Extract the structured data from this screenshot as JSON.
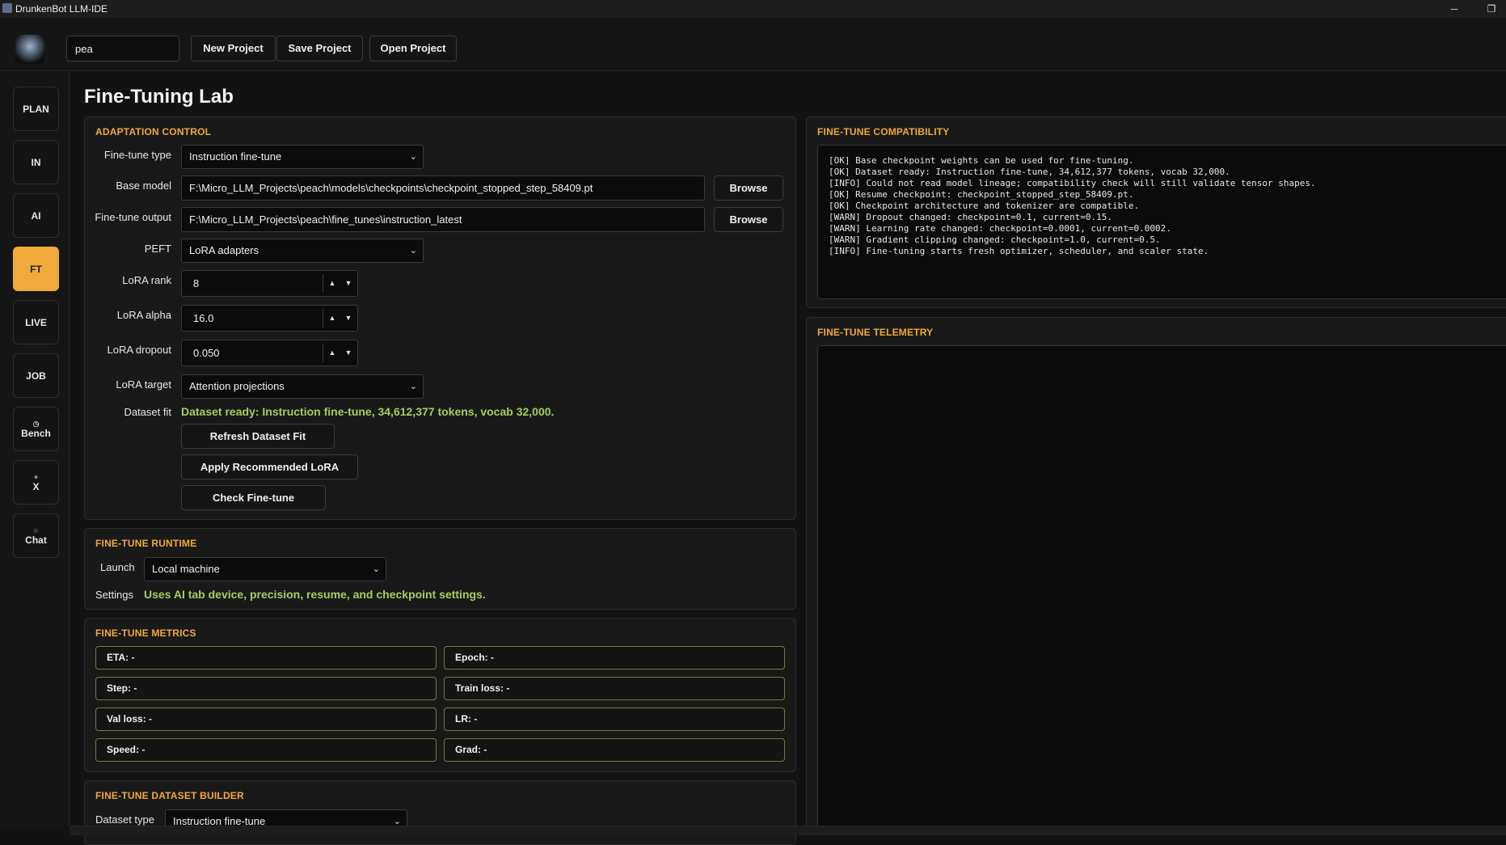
{
  "window": {
    "title": "DrunkenBot LLM-IDE",
    "minimize_glyph": "─",
    "restore_glyph": "❐"
  },
  "toolbar": {
    "project_value": "pea",
    "new_project": "New Project",
    "save_project": "Save Project",
    "open_project": "Open Project"
  },
  "sidebar": {
    "items": [
      {
        "label": "PLAN",
        "icon": ""
      },
      {
        "label": "IN",
        "icon": ""
      },
      {
        "label": "AI",
        "icon": ""
      },
      {
        "label": "FT",
        "icon": "",
        "active": true
      },
      {
        "label": "LIVE",
        "icon": ""
      },
      {
        "label": "JOB",
        "icon": ""
      },
      {
        "label": "Bench",
        "icon": "◷"
      },
      {
        "label": "X",
        "icon": "⚬"
      },
      {
        "label": "Chat",
        "icon": "○"
      }
    ]
  },
  "page": {
    "title": "Fine-Tuning Lab"
  },
  "adaptation": {
    "title": "ADAPTATION CONTROL",
    "finetune_type_label": "Fine-tune type",
    "finetune_type_value": "Instruction fine-tune",
    "base_model_label": "Base model",
    "base_model_value": "F:\\Micro_LLM_Projects\\peach\\models\\checkpoints\\checkpoint_stopped_step_58409.pt",
    "output_label": "Fine-tune output",
    "output_value": "F:\\Micro_LLM_Projects\\peach\\fine_tunes\\instruction_latest",
    "browse": "Browse",
    "peft_label": "PEFT",
    "peft_value": "LoRA adapters",
    "rank_label": "LoRA rank",
    "rank_value": "8",
    "alpha_label": "LoRA alpha",
    "alpha_value": "16.0",
    "dropout_label": "LoRA dropout",
    "dropout_value": "0.050",
    "target_label": "LoRA target",
    "target_value": "Attention projections",
    "dataset_fit_label": "Dataset fit",
    "dataset_fit_value": "Dataset ready: Instruction fine-tune, 34,612,377 tokens, vocab 32,000.",
    "refresh_btn": "Refresh Dataset Fit",
    "apply_btn": "Apply Recommended LoRA",
    "check_btn": "Check Fine-tune"
  },
  "runtime": {
    "title": "FINE-TUNE RUNTIME",
    "launch_label": "Launch",
    "launch_value": "Local machine",
    "settings_label": "Settings",
    "settings_value": "Uses AI tab device, precision, resume, and checkpoint settings."
  },
  "metrics": {
    "title": "FINE-TUNE METRICS",
    "items": [
      "ETA: -",
      "Epoch: -",
      "Step: -",
      "Train loss: -",
      "Val loss: -",
      "LR: -",
      "Speed: -",
      "Grad: -"
    ]
  },
  "dataset_builder": {
    "title": "FINE-TUNE DATASET BUILDER",
    "type_label": "Dataset type",
    "type_value": "Instruction fine-tune"
  },
  "compatibility": {
    "title": "FINE-TUNE COMPATIBILITY",
    "log": "[OK] Base checkpoint weights can be used for fine-tuning.\n[OK] Dataset ready: Instruction fine-tune, 34,612,377 tokens, vocab 32,000.\n[INFO] Could not read model lineage; compatibility check will still validate tensor shapes.\n[OK] Resume checkpoint: checkpoint_stopped_step_58409.pt.\n[OK] Checkpoint architecture and tokenizer are compatible.\n[WARN] Dropout changed: checkpoint=0.1, current=0.15.\n[WARN] Learning rate changed: checkpoint=0.0001, current=0.0002.\n[WARN] Gradient clipping changed: checkpoint=1.0, current=0.5.\n[INFO] Fine-tuning starts fresh optimizer, scheduler, and scaler state."
  },
  "telemetry": {
    "title": "FINE-TUNE TELEMETRY",
    "log": ""
  },
  "colors": {
    "accent": "#f0a93b",
    "ok_green": "#a4cf5d",
    "background": "#121212"
  }
}
